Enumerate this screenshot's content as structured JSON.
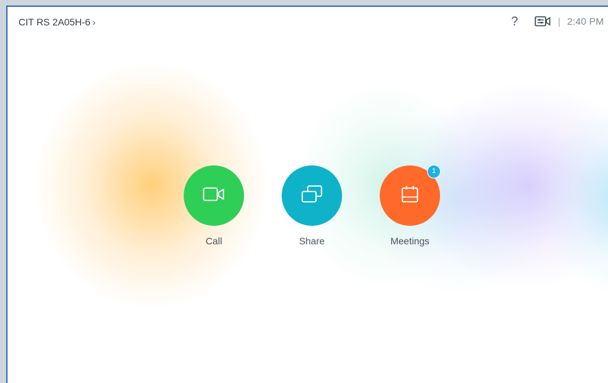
{
  "header": {
    "device_name": "CIT RS 2A05H-6",
    "chevron": "›",
    "help_icon": "?",
    "separator": "|",
    "time": "2:40 PM"
  },
  "actions": [
    {
      "label": "Call",
      "icon": "video-camera-icon",
      "color": "#2fcf57"
    },
    {
      "label": "Share",
      "icon": "share-screens-icon",
      "color": "#0fb3c9"
    },
    {
      "label": "Meetings",
      "icon": "calendar-icon",
      "color": "#ff6a2b",
      "badge": "1"
    }
  ],
  "colors": {
    "accent_border": "#3b70b5",
    "badge": "#1fb1e6"
  }
}
